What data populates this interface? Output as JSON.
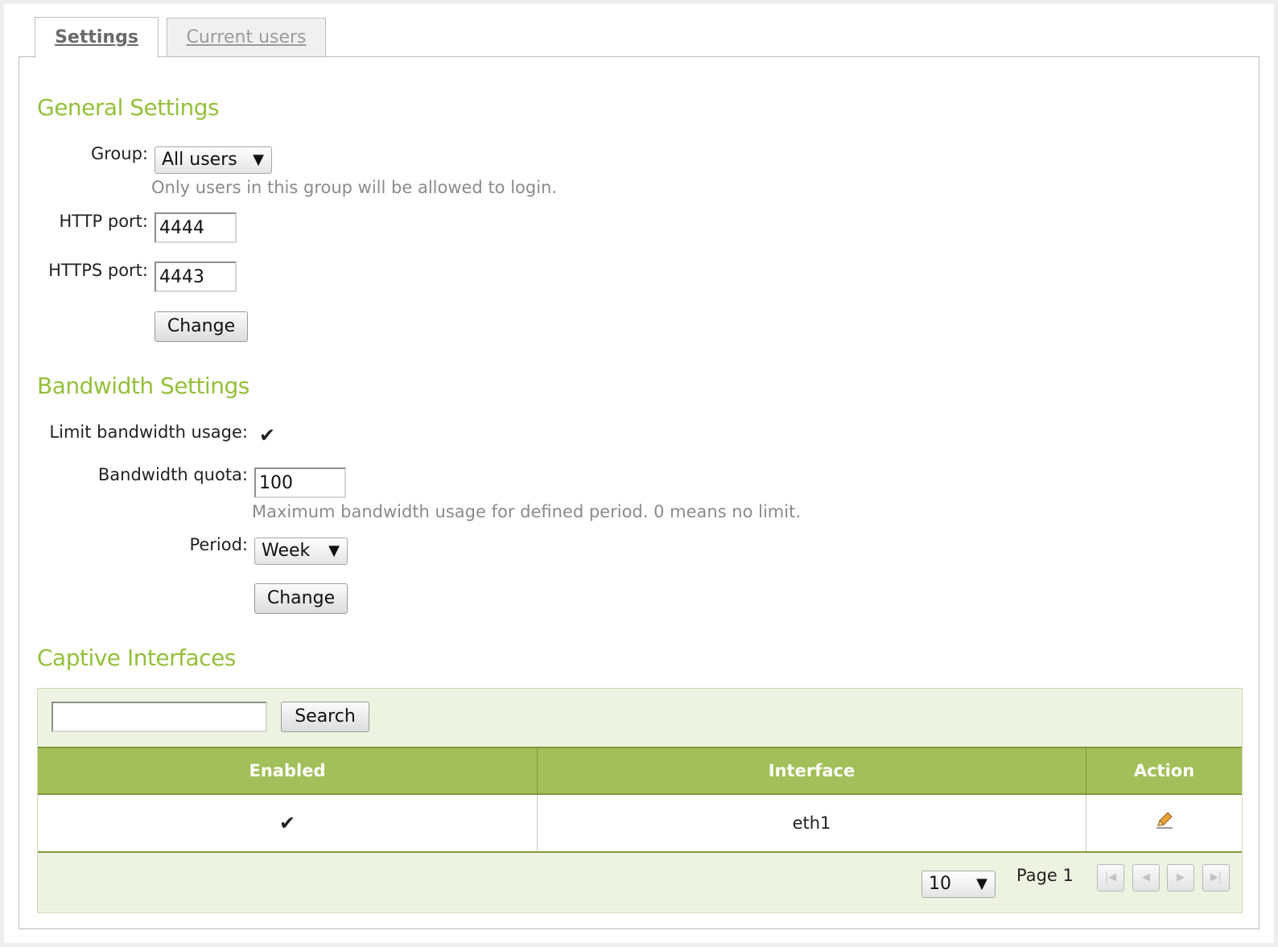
{
  "tabs": [
    {
      "label": "Settings",
      "active": true
    },
    {
      "label": "Current users",
      "active": false
    }
  ],
  "general": {
    "title": "General Settings",
    "group_label": "Group:",
    "group_value": "All users",
    "group_hint": "Only users in this group will be allowed to login.",
    "http_label": "HTTP port:",
    "http_value": "4444",
    "https_label": "HTTPS port:",
    "https_value": "4443",
    "change_label": "Change"
  },
  "bandwidth": {
    "title": "Bandwidth Settings",
    "limit_label": "Limit bandwidth usage:",
    "limit_checked": true,
    "quota_label": "Bandwidth quota:",
    "quota_value": "100",
    "quota_hint": "Maximum bandwidth usage for defined period. 0 means no limit.",
    "period_label": "Period:",
    "period_value": "Week",
    "change_label": "Change"
  },
  "captive": {
    "title": "Captive Interfaces",
    "search_value": "",
    "search_label": "Search",
    "columns": [
      "Enabled",
      "Interface",
      "Action"
    ],
    "rows": [
      {
        "enabled": true,
        "interface": "eth1",
        "action_icon": "edit-pencil-icon"
      }
    ],
    "page_size": "10",
    "page_label": "Page 1"
  },
  "colors": {
    "heading": "#94c03a",
    "grid_header": "#a2bf59",
    "grid_bg": "#eef3e1"
  }
}
